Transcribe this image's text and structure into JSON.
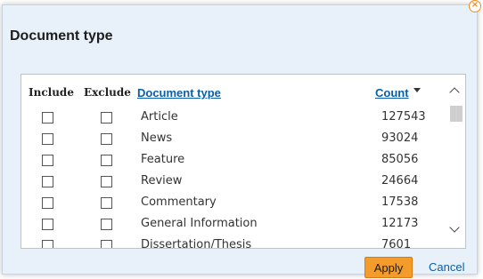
{
  "dialog": {
    "title": "Document type",
    "close_icon": "close-circle-icon",
    "apply_label": "Apply",
    "cancel_label": "Cancel"
  },
  "table": {
    "headers": {
      "include": "Include",
      "exclude": "Exclude",
      "document_type": "Document type",
      "count": "Count"
    },
    "sort_icon": "sort-down-icon",
    "rows": [
      {
        "label": "Article",
        "count": "127543"
      },
      {
        "label": "News",
        "count": "93024"
      },
      {
        "label": "Feature",
        "count": "85056"
      },
      {
        "label": "Review",
        "count": "24664"
      },
      {
        "label": "Commentary",
        "count": "17538"
      },
      {
        "label": "General Information",
        "count": "12173"
      },
      {
        "label": "Dissertation/Thesis",
        "count": "7601"
      }
    ]
  },
  "colors": {
    "accent": "#f39c2b",
    "link": "#0b5ea8",
    "dialog_bg": "#e8f1f9"
  }
}
